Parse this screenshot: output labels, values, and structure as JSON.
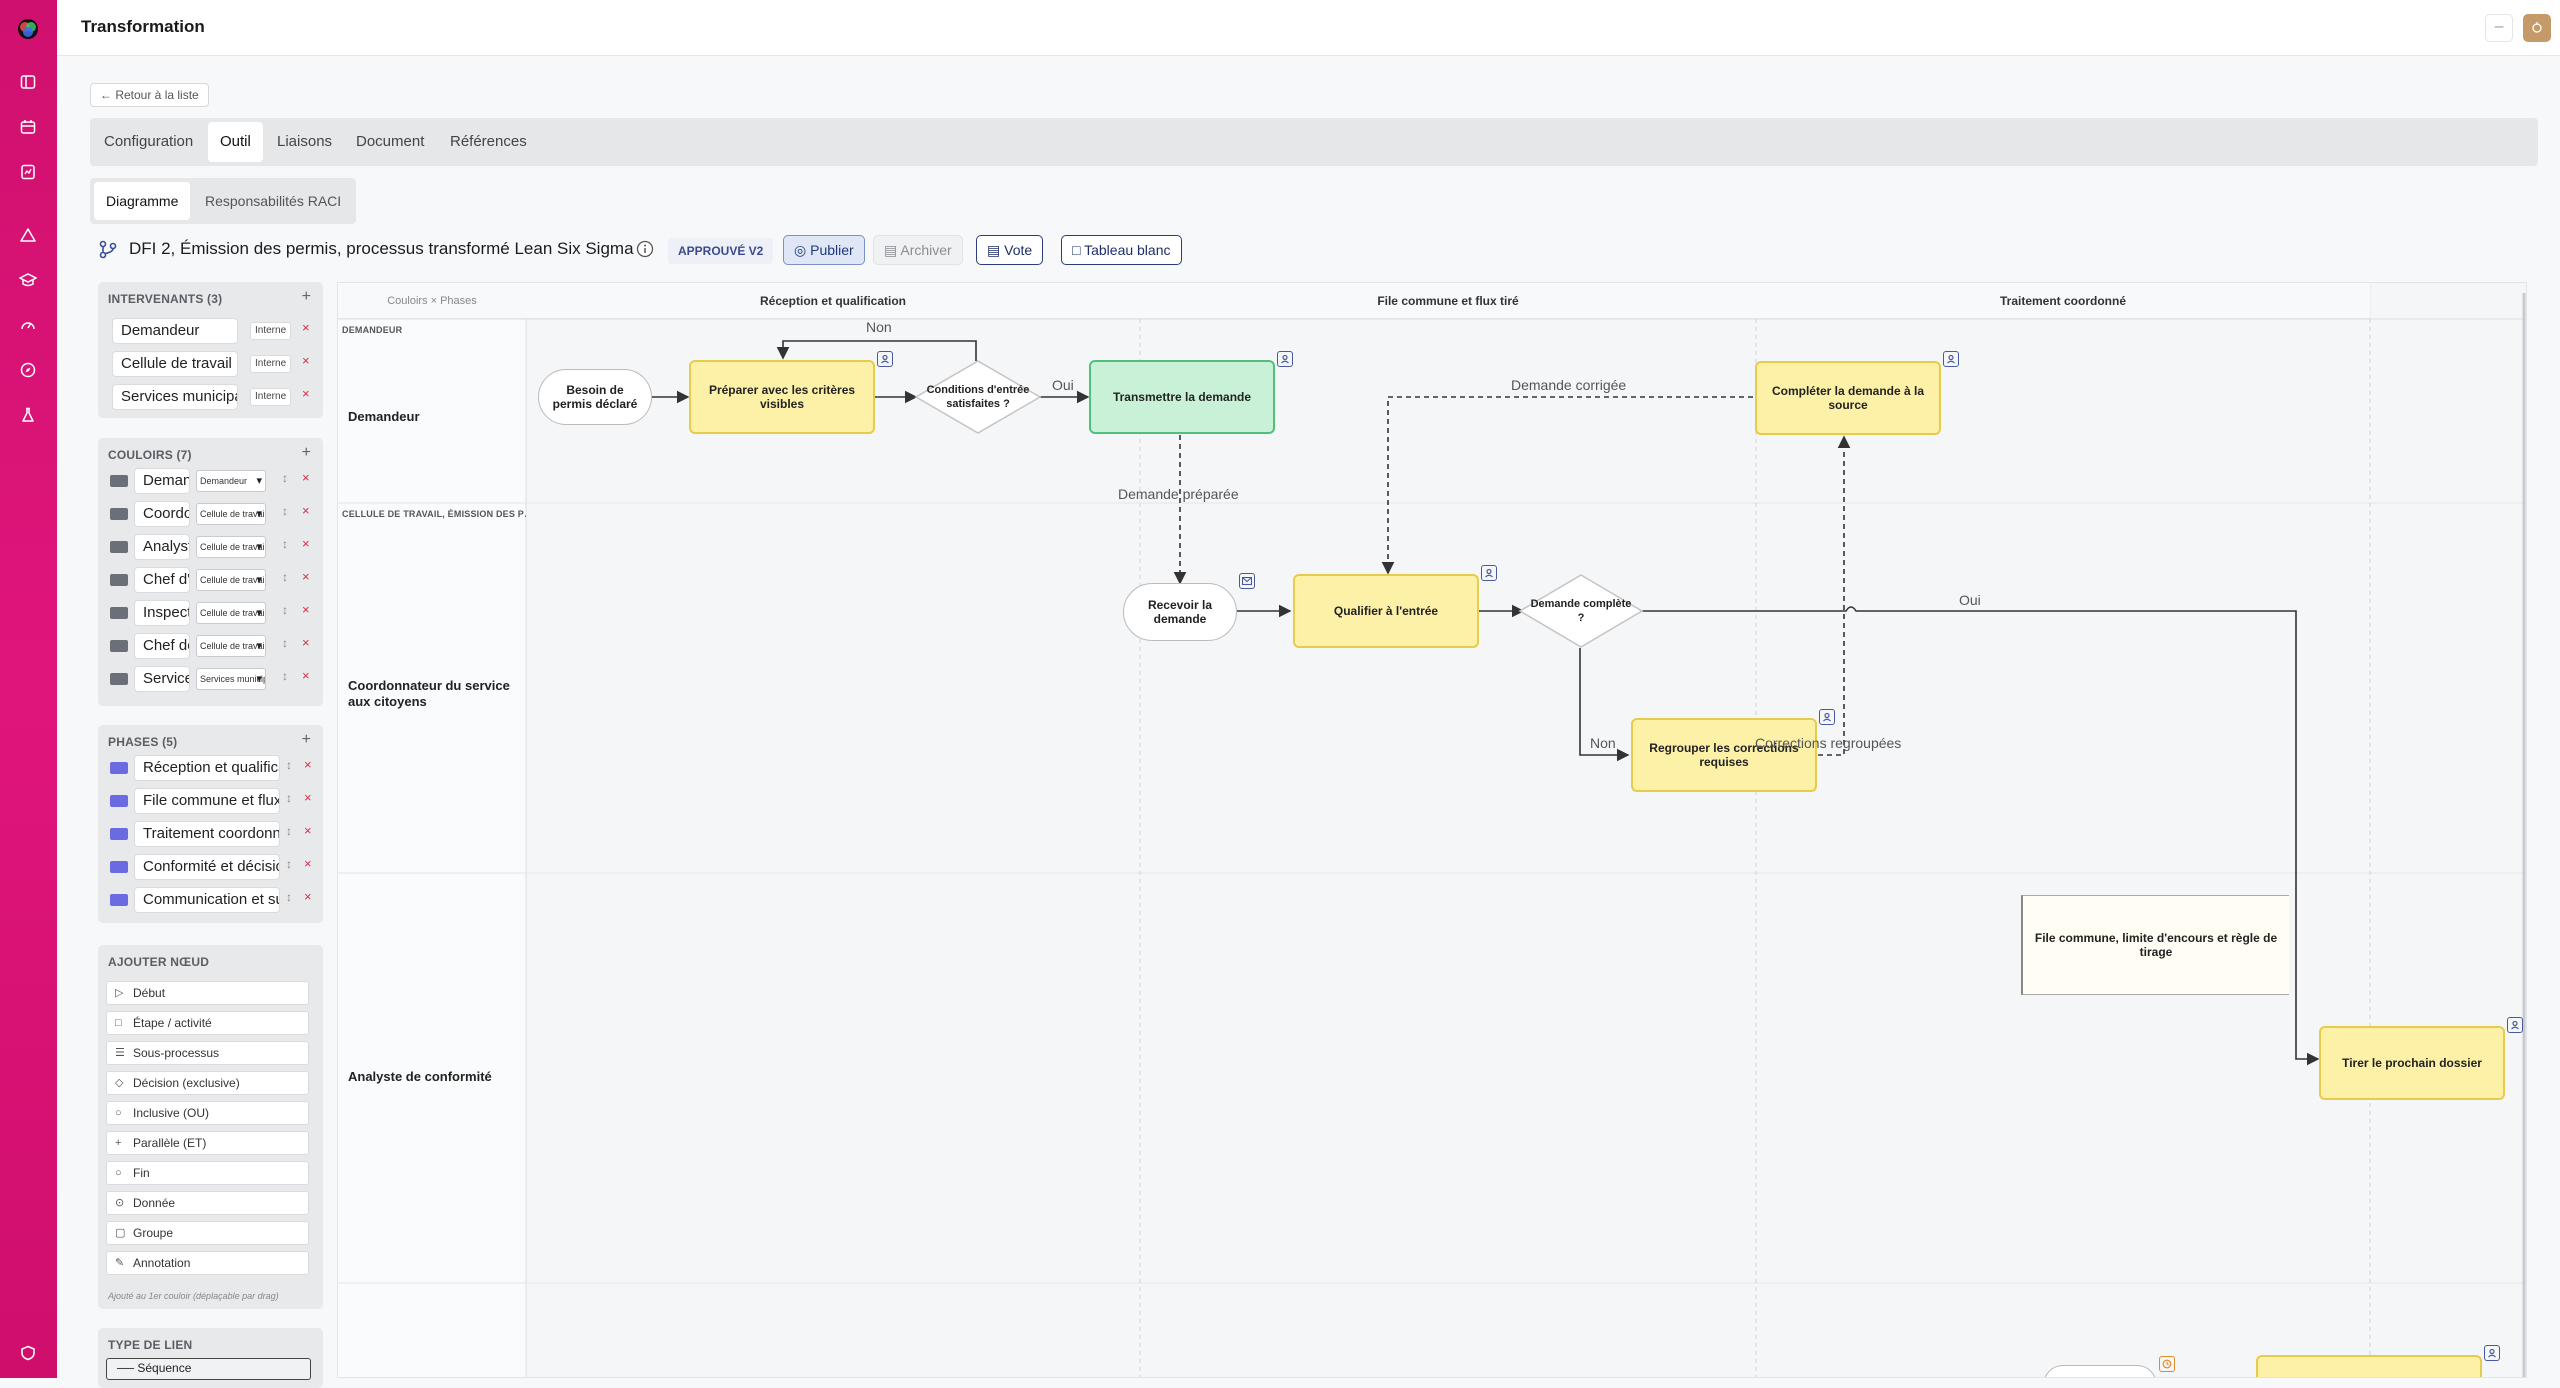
{
  "app": {
    "title": "Transformation"
  },
  "rail": {
    "icons": [
      "logo-icon",
      "sidebar-toggle-icon",
      "calendar-icon",
      "report-icon",
      "warning-icon",
      "education-icon",
      "gauge-icon",
      "compass-icon",
      "flask-icon",
      "shield-icon"
    ]
  },
  "nav": {
    "back_label": "← Retour à la liste",
    "tabs": [
      {
        "label": "Configuration"
      },
      {
        "label": "Outil"
      },
      {
        "label": "Liaisons"
      },
      {
        "label": "Document"
      },
      {
        "label": "Références"
      }
    ],
    "active_tab": "Outil",
    "subtabs": [
      {
        "label": "Diagramme"
      },
      {
        "label": "Responsabilités RACI"
      }
    ],
    "active_subtab": "Diagramme"
  },
  "header": {
    "process_title": "DFI 2, Émission des permis, processus transformé Lean Six Sigma",
    "status_badge": "APPROUVÉ V2",
    "publish_label": "Publier",
    "archive_label": "Archiver",
    "vote_label": "Vote",
    "whiteboard_label": "Tableau blanc"
  },
  "intervenants": {
    "title": "INTERVENANTS (3)",
    "add": "+",
    "items": [
      {
        "name": "Demandeur",
        "tag": "Interne",
        "remove": "×"
      },
      {
        "name": "Cellule de travail",
        "tag": "Interne",
        "remove": "×"
      },
      {
        "name": "Services municipaux",
        "tag": "Interne",
        "remove": "×"
      }
    ]
  },
  "couloirs": {
    "title": "COULOIRS (7)",
    "add": "+",
    "swatch_color": "#6b6f78",
    "items": [
      {
        "name": "Demandeur",
        "select": "Demandeur",
        "remove": "×"
      },
      {
        "name": "Coordonnateur",
        "select": "Cellule de travail",
        "remove": "×"
      },
      {
        "name": "Analyste",
        "select": "Cellule de travail",
        "remove": "×"
      },
      {
        "name": "Chef d'équipe",
        "select": "Cellule de travail",
        "remove": "×"
      },
      {
        "name": "Inspecteur",
        "select": "Cellule de travail",
        "remove": "×"
      },
      {
        "name": "Chef de division",
        "select": "Cellule de travail",
        "remove": "×"
      },
      {
        "name": "Services",
        "select": "Services municipaux",
        "remove": "×"
      }
    ]
  },
  "phases": {
    "title": "PHASES (5)",
    "add": "+",
    "swatch_color": "#6a6be0",
    "items": [
      {
        "name": "Réception et qualification",
        "remove": "×"
      },
      {
        "name": "File commune et flux tiré",
        "remove": "×"
      },
      {
        "name": "Traitement coordonné",
        "remove": "×"
      },
      {
        "name": "Conformité et décision",
        "remove": "×"
      },
      {
        "name": "Communication et suivi",
        "remove": "×"
      }
    ]
  },
  "add_node": {
    "title": "AJOUTER NŒUD",
    "items": [
      {
        "icon": "▷",
        "label": "Début",
        "name": "start"
      },
      {
        "icon": "□",
        "label": "Étape / activité",
        "name": "step"
      },
      {
        "icon": "☰",
        "label": "Sous-processus",
        "name": "subprocess"
      },
      {
        "icon": "◇",
        "label": "Décision (exclusive)",
        "name": "decision"
      },
      {
        "icon": "○",
        "label": "Inclusive (OU)",
        "name": "inclusive"
      },
      {
        "icon": "+",
        "label": "Parallèle (ET)",
        "name": "parallel"
      },
      {
        "icon": "○",
        "label": "Fin",
        "name": "end"
      },
      {
        "icon": "⊙",
        "label": "Donnée",
        "name": "data"
      },
      {
        "icon": "▢",
        "label": "Groupe",
        "name": "group"
      },
      {
        "icon": "✎",
        "label": "Annotation",
        "name": "annotation"
      }
    ],
    "hint": "Ajouté au 1er couloir (déplaçable par drag)"
  },
  "link_type": {
    "title": "TYPE DE LIEN",
    "selected": "Séquence"
  },
  "diagram": {
    "corner_label": "Couloirs × Phases",
    "phases": [
      "Réception et qualification",
      "File commune et flux tiré",
      "Traitement coordonné"
    ],
    "lanes": [
      {
        "tag": "DEMANDEUR",
        "name": "Demandeur"
      },
      {
        "tag": "CELLULE DE TRAVAIL, ÉMISSION DES P…",
        "name": "Coordonnateur du service aux citoyens"
      },
      {
        "tag": "",
        "name": "Analyste de conformité"
      }
    ],
    "nodes": {
      "n_besoin": "Besoin de permis déclaré",
      "n_preparer": "Préparer avec les critères visibles",
      "n_conditions": "Conditions d'entrée satisfaites ?",
      "n_transmettre": "Transmettre la demande",
      "n_completer": "Compléter la demande à la source",
      "n_recevoir": "Recevoir la demande",
      "n_qualifier": "Qualifier à l'entrée",
      "n_complete": "Demande complète ?",
      "n_regrouper": "Regrouper les corrections requises",
      "n_annot": "File commune, limite d'encours et règle de tirage",
      "n_tirer": "Tirer le prochain dossier"
    },
    "edges": {
      "e_non1": "Non",
      "e_oui1": "Oui",
      "e_corrigee": "Demande corrigée",
      "e_preparee": "Demande préparée",
      "e_oui2": "Oui",
      "e_non2": "Non",
      "e_regroupees": "Corrections regroupées"
    }
  }
}
